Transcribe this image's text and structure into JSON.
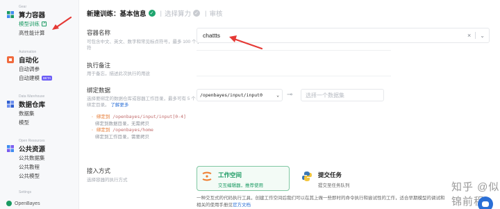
{
  "sidebar": {
    "sections": [
      {
        "en": "Gear",
        "title": "算力容器",
        "items": [
          {
            "label": "模型训练",
            "active": true
          },
          {
            "label": "高性能计算"
          }
        ]
      },
      {
        "en": "Automation",
        "title": "自动化",
        "items": [
          {
            "label": "自动调参"
          },
          {
            "label": "自动建模",
            "badge": "BETA"
          }
        ]
      },
      {
        "en": "Data Warehouse",
        "title": "数据仓库",
        "items": [
          {
            "label": "数据集"
          },
          {
            "label": "模型"
          }
        ]
      },
      {
        "en": "Open Resources",
        "title": "公共资源",
        "items": [
          {
            "label": "公共数据集"
          },
          {
            "label": "公共教程"
          },
          {
            "label": "公共模型"
          }
        ]
      }
    ],
    "settings_en": "Settings",
    "footer_brand": "OpenBayes"
  },
  "header": {
    "title": "新建训练：基本信息",
    "step2": "选择算力",
    "step3": "审核"
  },
  "form": {
    "name": {
      "label": "容器名称",
      "hint": "可包含中文、英文、数字和常见标点符号，最多 100 个字符",
      "value": "chattts"
    },
    "note": {
      "label": "执行备注",
      "hint": "用于备忘，描述此次执行的用途"
    },
    "binding": {
      "label": "绑定数据",
      "hint_text": "选择要绑定的数据仓库或容器工作目录，最多可有 5 个绑定目录。",
      "hint_link": "了解更多",
      "path_value": "/openbayes/input/input0",
      "dataset_placeholder": "选择一个数据集",
      "list": [
        {
          "kw": "· 绑定到",
          "path": "/openbayes/input/input[0-4]",
          "desc": "绑定到数据目录，无需拷贝"
        },
        {
          "kw": "· 绑定到",
          "path": "/openbayes/home",
          "desc": "绑定到工作目录，需要拷贝"
        }
      ]
    },
    "access": {
      "label": "接入方式",
      "hint": "选择容器的执行方式",
      "options": [
        {
          "title": "工作空间",
          "subtitle": "交互编辑器，推荐使用",
          "selected": true
        },
        {
          "title": "提交任务",
          "subtitle": "提交至任务队列",
          "selected": false
        }
      ],
      "desc_text": "一种交互式的代码执行工具，创建工作空间后我们可以在其上做一些即时的命令执行和尝试性的工作，适合早期模型的调试和",
      "desc_text2": "相关的使用手册见",
      "desc_link": "官方文档"
    }
  },
  "watermark": "知乎 @似锦前程",
  "colors": {
    "accent": "#1a9a62",
    "annotation_arrow": "#e53935",
    "link": "#2b6fd6"
  }
}
